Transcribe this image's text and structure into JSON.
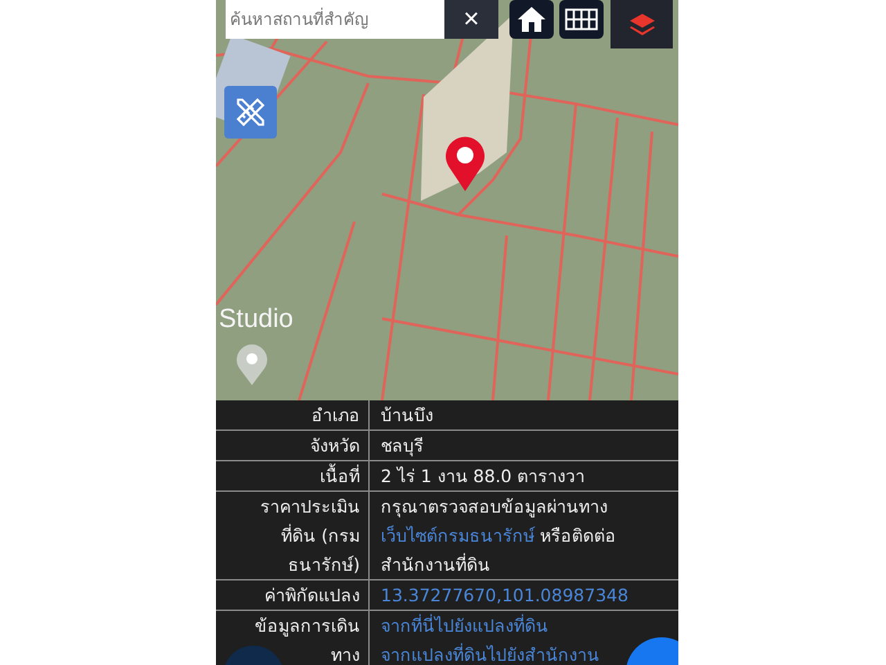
{
  "search": {
    "placeholder": "ค้นหาสถานที่สำคัญ",
    "clear": "×"
  },
  "map": {
    "label": "Studio"
  },
  "details": [
    {
      "label": [
        "อำเภอ"
      ],
      "value": [
        [
          {
            "kind": "text",
            "text": "บ้านบึง"
          }
        ]
      ]
    },
    {
      "label": [
        "จังหวัด"
      ],
      "value": [
        [
          {
            "kind": "text",
            "text": "ชลบุรี"
          }
        ]
      ]
    },
    {
      "label": [
        "เนื้อที่"
      ],
      "value": [
        [
          {
            "kind": "text",
            "text": "2 ไร่ 1 งาน 88.0 ตารางวา"
          }
        ]
      ]
    },
    {
      "label": [
        "ราคาประเมิน",
        "ที่ดิน (กรม",
        "ธนารักษ์)"
      ],
      "value": [
        [
          {
            "kind": "text",
            "text": "กรุณาตรวจสอบข้อมูลผ่านทาง"
          }
        ],
        [
          {
            "kind": "link",
            "text": "เว็บไซต์กรมธนารักษ์"
          },
          {
            "kind": "text",
            "text": " หรือติดต่อ"
          }
        ],
        [
          {
            "kind": "text",
            "text": "สำนักงานที่ดิน"
          }
        ]
      ]
    },
    {
      "label": [
        "ค่าพิกัดแปลง"
      ],
      "value": [
        [
          {
            "kind": "link",
            "text": "13.37277670,101.08987348"
          }
        ]
      ]
    },
    {
      "label": [
        "ข้อมูลการเดิน",
        "ทาง"
      ],
      "value": [
        [
          {
            "kind": "link",
            "text": "จากที่นี่ไปยังแปลงที่ดิน"
          }
        ],
        [
          {
            "kind": "link",
            "text": "จากแปลงที่ดินไปยังสำนักงาน"
          }
        ]
      ]
    }
  ]
}
